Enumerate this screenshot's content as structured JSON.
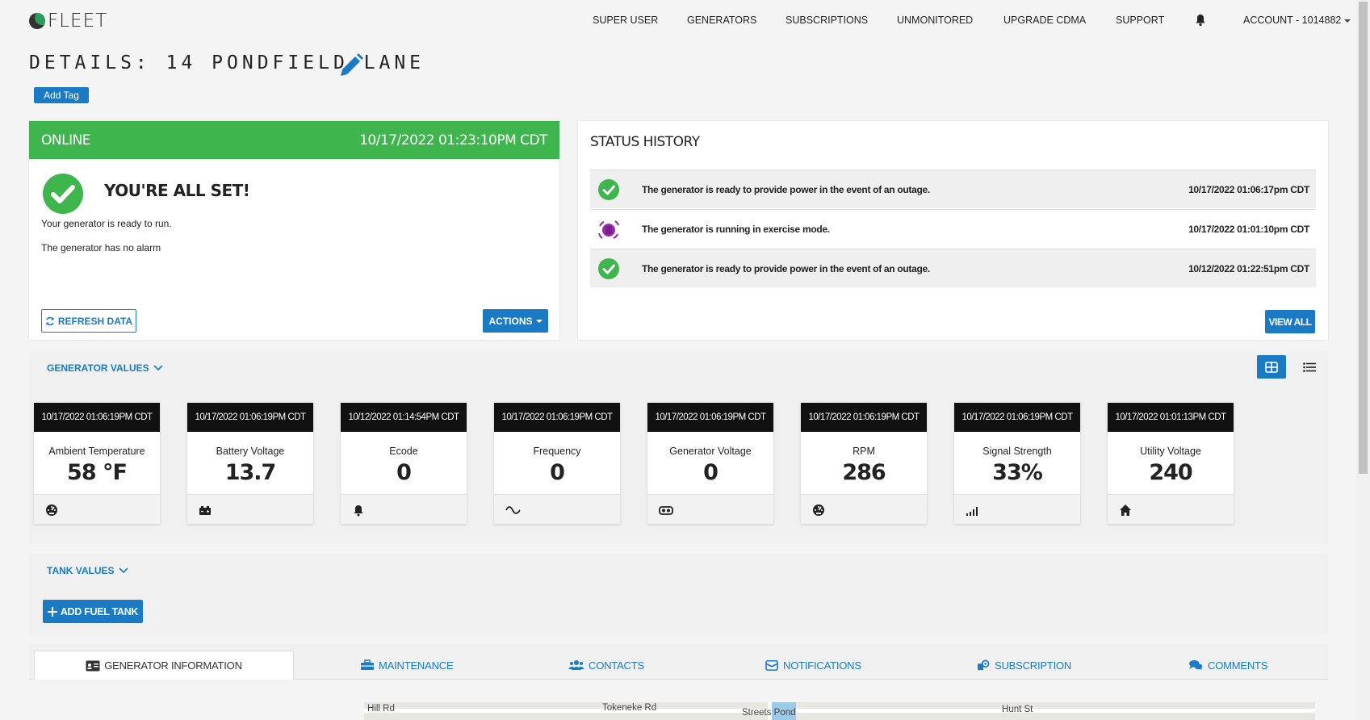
{
  "nav": {
    "logo_text": "FLEET",
    "items": [
      "SUPER USER",
      "GENERATORS",
      "SUBSCRIPTIONS",
      "UNMONITORED",
      "UPGRADE CDMA",
      "SUPPORT"
    ],
    "account": "ACCOUNT - 1014882"
  },
  "page": {
    "title": "DETAILS: 14 PONDFIELD LANE",
    "add_tag": "Add Tag"
  },
  "status": {
    "state": "ONLINE",
    "timestamp": "10/17/2022 01:23:10PM CDT",
    "headline": "YOU'RE ALL SET!",
    "line1": "Your generator is ready to run.",
    "line2": "The generator has no alarm",
    "refresh_label": "REFRESH DATA",
    "actions_label": "ACTIONS",
    "color": "#3fb54d"
  },
  "history": {
    "title": "STATUS HISTORY",
    "view_all": "VIEW ALL",
    "rows": [
      {
        "icon": "check-circle-icon",
        "text": "The generator is ready to provide power in the event of an outage.",
        "time": "10/17/2022 01:06:17pm CDT"
      },
      {
        "icon": "exercise-icon",
        "text": "The generator is running in exercise mode.",
        "time": "10/17/2022 01:01:10pm CDT"
      },
      {
        "icon": "check-circle-icon",
        "text": "The generator is ready to provide power in the event of an outage.",
        "time": "10/12/2022 01:22:51pm CDT"
      }
    ]
  },
  "generator_values": {
    "label": "GENERATOR VALUES",
    "tiles": [
      {
        "time": "10/17/2022 01:06:19PM CDT",
        "name": "Ambient Temperature",
        "value": "58 °F",
        "icon": "gauge-icon"
      },
      {
        "time": "10/17/2022 01:06:19PM CDT",
        "name": "Battery Voltage",
        "value": "13.7",
        "icon": "battery-icon"
      },
      {
        "time": "10/12/2022 01:14:54PM CDT",
        "name": "Ecode",
        "value": "0",
        "icon": "bell-icon"
      },
      {
        "time": "10/17/2022 01:06:19PM CDT",
        "name": "Frequency",
        "value": "0",
        "icon": "sine-wave-icon"
      },
      {
        "time": "10/17/2022 01:06:19PM CDT",
        "name": "Generator Voltage",
        "value": "0",
        "icon": "generator-icon"
      },
      {
        "time": "10/17/2022 01:06:19PM CDT",
        "name": "RPM",
        "value": "286",
        "icon": "gauge-icon"
      },
      {
        "time": "10/17/2022 01:06:19PM CDT",
        "name": "Signal Strength",
        "value": "33%",
        "icon": "signal-icon"
      },
      {
        "time": "10/17/2022 01:01:13PM CDT",
        "name": "Utility Voltage",
        "value": "240",
        "icon": "home-icon"
      }
    ]
  },
  "tank_values": {
    "label": "TANK VALUES",
    "add_label": "ADD FUEL TANK"
  },
  "tabs": [
    {
      "label": "GENERATOR INFORMATION",
      "icon": "id-card-icon"
    },
    {
      "label": "MAINTENANCE",
      "icon": "toolbox-icon"
    },
    {
      "label": "CONTACTS",
      "icon": "users-icon"
    },
    {
      "label": "NOTIFICATIONS",
      "icon": "notification-icon"
    },
    {
      "label": "SUBSCRIPTION",
      "icon": "subscription-icon"
    },
    {
      "label": "COMMENTS",
      "icon": "comments-icon"
    }
  ],
  "map": {
    "labels": [
      "Hill Rd",
      "Tokeneke Rd",
      "Streets Pond",
      "Hunt St"
    ]
  }
}
